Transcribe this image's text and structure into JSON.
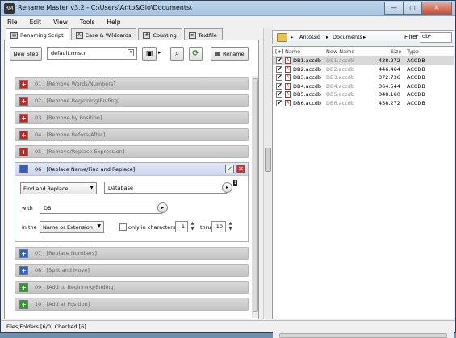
{
  "window": {
    "app_icon": "RM",
    "title": "Rename Master v3.2 - C:\\Users\\Anto&Gio\\Documents\\",
    "buttons": [
      "—",
      "□",
      "✕"
    ]
  },
  "menu": [
    "File",
    "Edit",
    "View",
    "Tools",
    "Help"
  ],
  "tabs": [
    {
      "label": "Renaming Script",
      "icon": "script-icon"
    },
    {
      "label": "Case & Wildcards",
      "icon": "case-icon"
    },
    {
      "label": "Counting",
      "icon": "counting-icon"
    },
    {
      "label": "Textfile",
      "icon": "textfile-icon"
    }
  ],
  "toolbar": {
    "new_step": "New Step",
    "script_name": "default.rmscr",
    "rename": "Rename"
  },
  "steps_before": [
    {
      "label": "01 : [Remove Words/Numbers]",
      "color": "red"
    },
    {
      "label": "02 : [Remove Beginning/Ending]",
      "color": "red"
    },
    {
      "label": "03 : [Remove by Position]",
      "color": "red"
    },
    {
      "label": "04 : [Remove Before/After]",
      "color": "red"
    },
    {
      "label": "05 : [Remove/Replace Expression]",
      "color": "red"
    }
  ],
  "expanded_step": {
    "label": "06 : [Replace Name/Find and Replace]",
    "mode": "Find and Replace",
    "find_value": "Database",
    "with_label": "with",
    "with_value": "DB",
    "in_the_label": "in the",
    "in_the_value": "Name or Extension",
    "only_in_chars": "only in characters",
    "from": "1",
    "thru_label": "thru",
    "thru": "10",
    "marker": "!"
  },
  "steps_after": [
    {
      "label": "07 : [Replace Numbers]",
      "color": "blue"
    },
    {
      "label": "08 : [Split and Move]",
      "color": "blue"
    },
    {
      "label": "09 : [Add to Beginning/Ending]",
      "color": "green"
    },
    {
      "label": "10 : [Add at Position]",
      "color": "green"
    }
  ],
  "path": {
    "segments": [
      "AntoGio",
      "Documents"
    ],
    "filter_label": "Filter",
    "filter_value": "db*"
  },
  "list": {
    "headers": [
      "[+]",
      "Name",
      "New Name",
      "Size",
      "Type"
    ],
    "rows": [
      {
        "name": "DB1.accdb",
        "new_name": "DB1.accdb",
        "size": "438.272",
        "type": "ACCDB",
        "checked": true
      },
      {
        "name": "DB2.accdb",
        "new_name": "DB2.accdb",
        "size": "446.464",
        "type": "ACCDB",
        "checked": true
      },
      {
        "name": "DB3.accdb",
        "new_name": "DB3.accdb",
        "size": "372.736",
        "type": "ACCDB",
        "checked": true
      },
      {
        "name": "DB4.accdb",
        "new_name": "DB4.accdb",
        "size": "364.544",
        "type": "ACCDB",
        "checked": true
      },
      {
        "name": "DB5.accdb",
        "new_name": "DB5.accdb",
        "size": "348.160",
        "type": "ACCDB",
        "checked": true
      },
      {
        "name": "DB6.accdb",
        "new_name": "DB6.accdb",
        "size": "438.272",
        "type": "ACCDB",
        "checked": true
      }
    ]
  },
  "status": "Files/Folders [6/0] Checked [6]"
}
